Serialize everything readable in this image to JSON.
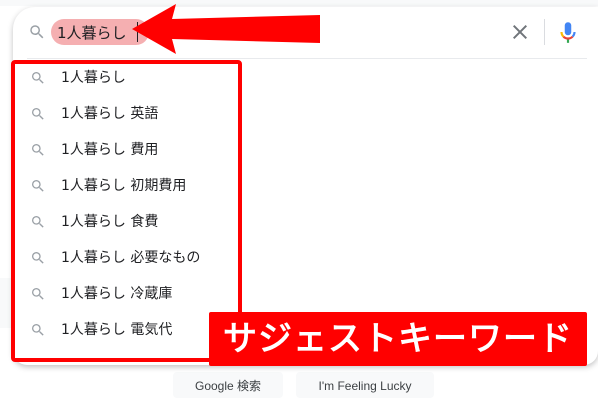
{
  "search": {
    "query": "1人暮らし",
    "clear_icon": "close-icon",
    "mic_icon": "microphone-icon",
    "search_icon": "search-icon"
  },
  "suggestions": [
    {
      "text": "1人暮らし"
    },
    {
      "text": "1人暮らし 英語"
    },
    {
      "text": "1人暮らし 費用"
    },
    {
      "text": "1人暮らし 初期費用"
    },
    {
      "text": "1人暮らし 食費"
    },
    {
      "text": "1人暮らし 必要なもの"
    },
    {
      "text": "1人暮らし 冷蔵庫"
    },
    {
      "text": "1人暮らし 電気代"
    }
  ],
  "buttons": {
    "google_search": "Google 検索",
    "feeling_lucky": "I'm Feeling Lucky"
  },
  "annotation": {
    "label": "サジェストキーワード",
    "color": "#ff0000",
    "arrow_icon": "left-arrow-icon"
  },
  "colors": {
    "mic_blue": "#4285f4",
    "mic_red": "#ea4335",
    "mic_yellow": "#fbbc04",
    "mic_green": "#34a853",
    "highlight": "#f4a6a8"
  }
}
